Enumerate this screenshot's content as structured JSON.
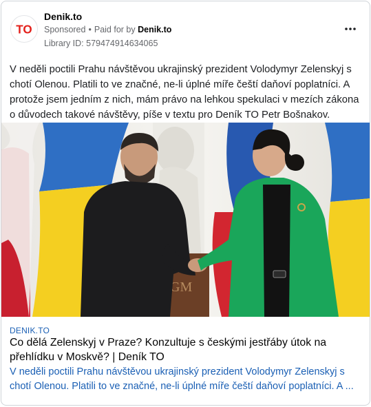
{
  "ad": {
    "page_name": "Denik.to",
    "sponsored_label": "Sponsored",
    "separator": "•",
    "paid_for_by_prefix": "Paid for by",
    "paid_for_by_name": "Denik.to",
    "library_id": "Library ID: 579474914634065",
    "logo_text": "TO",
    "more_icon": "more-horizontal-icon",
    "brand_color": "#e3201b"
  },
  "post": {
    "body_text": "V neděli poctili Prahu návštěvou ukrajinský prezident Volodymyr Zelenskyj s chotí Olenou. Platili to ve značné, ne-li úplné míře čeští daňoví poplatníci. A protože jsem jedním z nich, mám právo na lehkou spekulaci v mezích zákona o důvodech takové návštěvy, píše v textu pro Deník TO Petr Bošnakov.",
    "image_sign_text": "GM"
  },
  "link_preview": {
    "domain": "DENIK.TO",
    "title": "Co dělá Zelenskyj v Praze? Konzultuje s českými jestřáby útok na přehlídku v Moskvě? | Deník TO",
    "description": "V neděli poctili Prahu návštěvou ukrajinský prezident Volodymyr Zelenskyj s chotí Olenou. Platili to ve značné, ne-li úplné míře čeští daňoví poplatníci. A ...",
    "link_color": "#1a5fb4"
  }
}
